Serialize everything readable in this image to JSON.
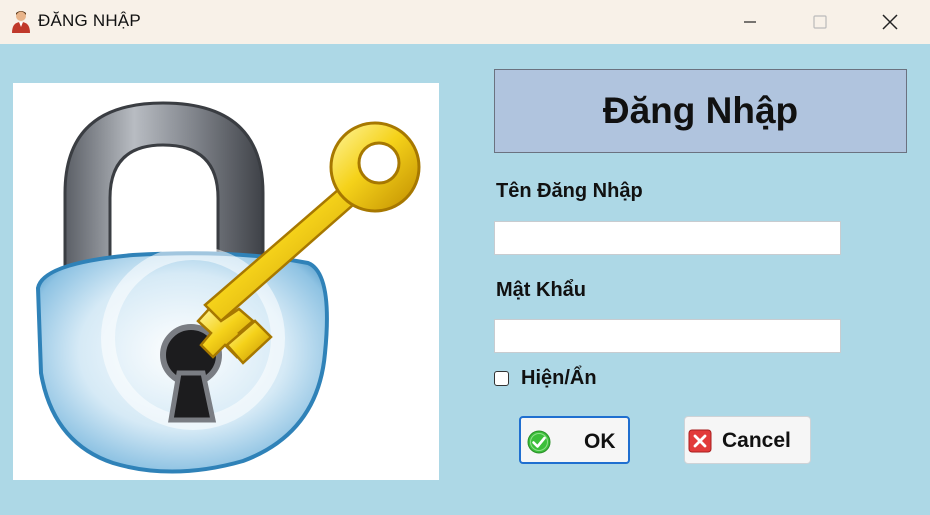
{
  "window": {
    "title": "ĐĂNG NHẬP",
    "icon": "user-icon",
    "controls": [
      "minimize-icon",
      "maximize-icon",
      "close-icon"
    ]
  },
  "image": {
    "icon": "padlock-key-icon"
  },
  "form": {
    "header": "Đăng Nhập",
    "username_label": "Tên Đăng Nhập",
    "username_value": "",
    "password_label": "Mật Khẩu",
    "password_value": "",
    "show_label": "Hiện/Ẩn",
    "show_checked": false
  },
  "buttons": {
    "ok_label": "OK",
    "ok_icon": "check-circle-icon",
    "cancel_label": "Cancel",
    "cancel_icon": "x-square-icon"
  },
  "colors": {
    "window_bg": "#add8e6",
    "titlebar_bg": "#f8f1e8",
    "header_bg": "#b0c4de",
    "ok_border": "#1f6fd0"
  }
}
